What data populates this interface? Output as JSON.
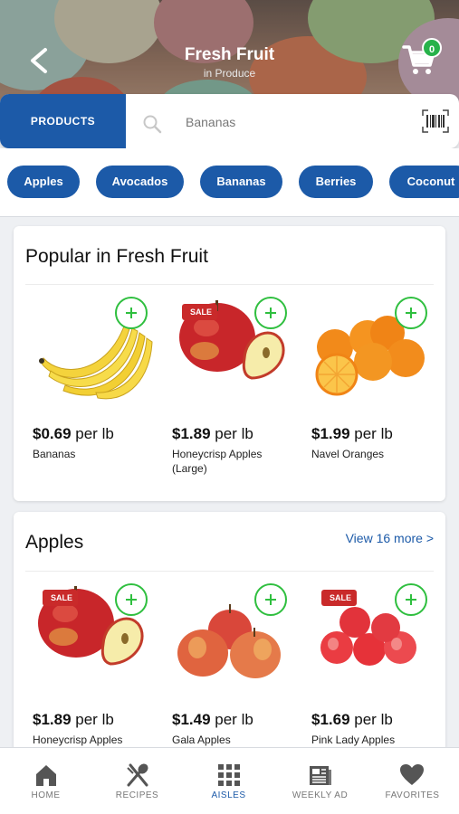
{
  "header": {
    "title": "Fresh Fruit",
    "subtitle": "in Produce",
    "back_icon": "chevron-left-icon",
    "cart_icon": "cart-icon",
    "cart_count": "0"
  },
  "search": {
    "mode_button": "PRODUCTS",
    "value": "Bananas",
    "search_icon": "search-icon",
    "barcode_icon": "barcode-icon"
  },
  "chips": [
    "Apples",
    "Avocados",
    "Bananas",
    "Berries",
    "Coconut"
  ],
  "sections": [
    {
      "title": "Popular in Fresh Fruit",
      "link": "",
      "products": [
        {
          "price": "$0.69",
          "unit": " per lb",
          "name": "Bananas",
          "sale": false
        },
        {
          "price": "$1.89",
          "unit": " per lb",
          "name": "Honeycrisp Apples (Large)",
          "sale": true
        },
        {
          "price": "$1.99",
          "unit": " per lb",
          "name": "Navel Oranges",
          "sale": false
        }
      ]
    },
    {
      "title": "Apples",
      "link": "View 16 more >",
      "products": [
        {
          "price": "$1.89",
          "unit": " per lb",
          "name": "Honeycrisp Apples (Large)",
          "sale": true
        },
        {
          "price": "$1.49",
          "unit": " per lb",
          "name": "Gala Apples",
          "sale": false
        },
        {
          "price": "$1.69",
          "unit": " per lb",
          "name": "Pink Lady Apples",
          "sale": true
        }
      ]
    }
  ],
  "sale_label": "SALE",
  "nav": [
    {
      "label": "HOME",
      "icon": "home-icon",
      "active": false
    },
    {
      "label": "RECIPES",
      "icon": "fork-spoon-icon",
      "active": false
    },
    {
      "label": "AISLES",
      "icon": "grid-icon",
      "active": true
    },
    {
      "label": "WEEKLY AD",
      "icon": "newspaper-icon",
      "active": false
    },
    {
      "label": "FAVORITES",
      "icon": "heart-icon",
      "active": false
    }
  ],
  "colors": {
    "brand_blue": "#1c5aa8",
    "add_green": "#2fbf3f",
    "sale_red": "#c92a2a",
    "badge_green": "#27b24a"
  }
}
